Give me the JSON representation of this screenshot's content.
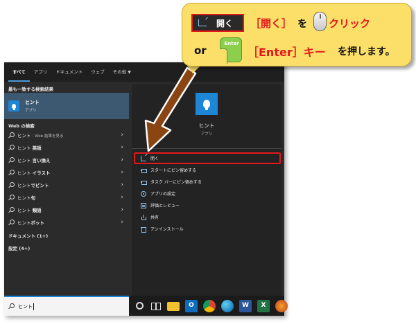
{
  "tabs": [
    {
      "label": "すべて",
      "active": true
    },
    {
      "label": "アプリ"
    },
    {
      "label": "ドキュメント"
    },
    {
      "label": "ウェブ"
    },
    {
      "label": "その他",
      "dropdown": true
    }
  ],
  "best_match": {
    "section_title": "最も一致する検索結果",
    "name": "ヒント",
    "type": "アプリ"
  },
  "web_section_title": "Web の検索",
  "web_results": [
    {
      "term": "ヒント",
      "bold": "",
      "suffix": "- Web 結果を見る"
    },
    {
      "term": "ヒント ",
      "bold": "英語",
      "suffix": ""
    },
    {
      "term": "ヒント ",
      "bold": "言い換え",
      "suffix": ""
    },
    {
      "term": "ヒント ",
      "bold": "イラスト",
      "suffix": ""
    },
    {
      "term": "ヒント",
      "bold": "でビント",
      "suffix": ""
    },
    {
      "term": "ヒント",
      "bold": "句",
      "suffix": ""
    },
    {
      "term": "ヒント ",
      "bold": "類語",
      "suffix": ""
    },
    {
      "term": "ヒント",
      "bold": "ボット",
      "suffix": ""
    }
  ],
  "documents_label": "ドキュメント (1+)",
  "settings_label": "設定 (4+)",
  "preview": {
    "name": "ヒント",
    "type": "アプリ"
  },
  "actions": [
    {
      "label": "開く",
      "icon": "open-icon"
    },
    {
      "label": "スタートにピン留めする",
      "icon": "pin-icon"
    },
    {
      "label": "タスク バーにピン留めする",
      "icon": "pin-icon"
    },
    {
      "label": "アプリの設定",
      "icon": "gear-icon"
    },
    {
      "label": "評価とレビュー",
      "icon": "rate-icon"
    },
    {
      "label": "共有",
      "icon": "share-icon"
    },
    {
      "label": "アンインストール",
      "icon": "trash-icon"
    }
  ],
  "search": {
    "value": "ヒント"
  },
  "taskbar": {
    "outlook": "O",
    "word": "W",
    "excel": "X"
  },
  "callout": {
    "key_open_label": "開く",
    "line1_open": "［開く］",
    "line1_wo": "を",
    "line1_click": "クリック",
    "or": "or",
    "enter_key": "Enter",
    "line2_enter": "［Enter］キー",
    "line2_push": "を押します。"
  },
  "colors": {
    "accent_blue": "#1e86d6",
    "highlight_red": "#e3181b",
    "callout_yellow": "#fbdf69",
    "arrow_brown": "#8a4513"
  }
}
